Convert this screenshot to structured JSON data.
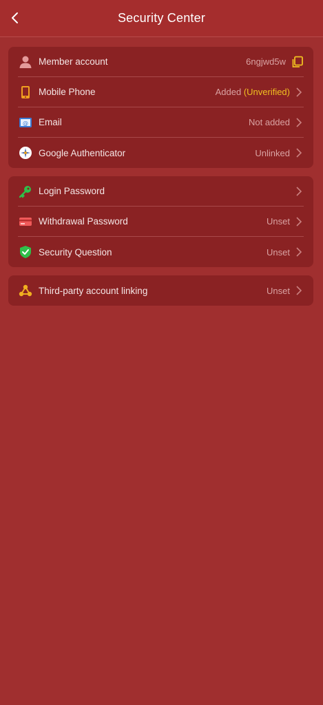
{
  "header": {
    "title": "Security Center"
  },
  "groups": [
    {
      "items": [
        {
          "label": "Member account",
          "value": "6ngjwd5w"
        },
        {
          "label": "Mobile Phone",
          "value": "Added ",
          "value_warn": "(Unverified)"
        },
        {
          "label": "Email",
          "value": "Not added"
        },
        {
          "label": "Google Authenticator",
          "value": "Unlinked"
        }
      ]
    },
    {
      "items": [
        {
          "label": "Login Password",
          "value": ""
        },
        {
          "label": "Withdrawal Password",
          "value": "Unset"
        },
        {
          "label": "Security Question",
          "value": "Unset"
        }
      ]
    },
    {
      "items": [
        {
          "label": "Third-party account linking",
          "value": "Unset"
        }
      ]
    }
  ],
  "colors": {
    "background": "#a02f2f",
    "card": "#8a2223",
    "accent": "#f0c020"
  }
}
